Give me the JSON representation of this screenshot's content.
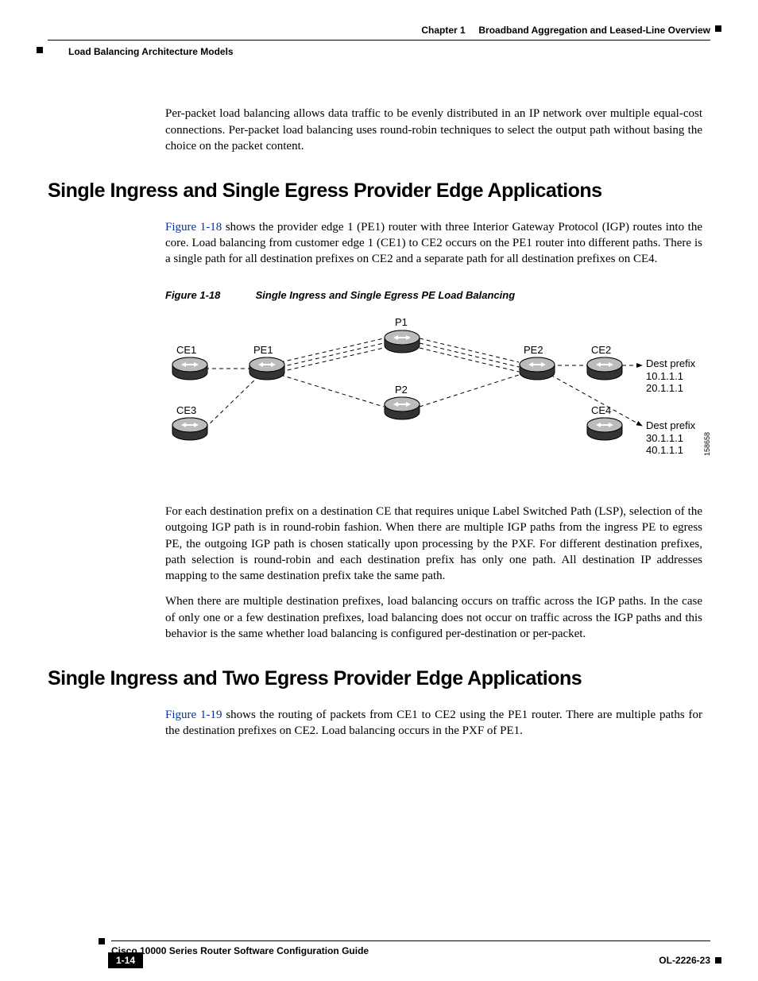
{
  "header": {
    "chapter": "Chapter 1",
    "title": "Broadband Aggregation and Leased-Line Overview",
    "section": "Load Balancing Architecture Models"
  },
  "intro": "Per-packet load balancing allows data traffic to be evenly distributed in an IP network over multiple equal-cost connections. Per-packet load balancing uses round-robin techniques to select the output path without basing the choice on the packet content.",
  "sec1": {
    "heading": "Single Ingress and Single Egress Provider Edge Applications",
    "p1_link": "Figure 1-18",
    "p1_rest": " shows the provider edge 1 (PE1) router with three Interior Gateway Protocol (IGP) routes into the core. Load balancing from customer edge 1 (CE1) to CE2 occurs on the PE1 router into different paths. There is a single path for all destination prefixes on CE2 and a separate path for all destination prefixes on CE4.",
    "fig_num": "Figure 1-18",
    "fig_title": "Single Ingress and Single Egress PE Load Balancing",
    "p2": "For each destination prefix on a destination CE that requires unique Label Switched Path (LSP), selection of the outgoing IGP path is in round-robin fashion. When there are multiple IGP paths from the ingress PE to egress PE, the outgoing IGP path is chosen statically upon processing by the PXF. For different destination prefixes, path selection is round-robin and each destination prefix has only one path. All destination IP addresses mapping to the same destination prefix take the same path.",
    "p3": "When there are multiple destination prefixes, load balancing occurs on traffic across the IGP paths. In the case of only one or a few destination prefixes, load balancing does not occur on traffic across the IGP paths and this behavior is the same whether load balancing is configured per-destination or per-packet."
  },
  "sec2": {
    "heading": "Single Ingress and Two Egress Provider Edge Applications",
    "p1_link": "Figure 1-19",
    "p1_rest": " shows the routing of packets from CE1 to CE2 using the PE1 router. There are multiple paths for the destination prefixes on CE2. Load balancing occurs in the PXF of PE1."
  },
  "diagram": {
    "nodes": {
      "ce1": "CE1",
      "ce3": "CE3",
      "pe1": "PE1",
      "p1": "P1",
      "p2": "P2",
      "pe2": "PE2",
      "ce2": "CE2",
      "ce4": "CE4"
    },
    "dest1": {
      "t": "Dest prefix",
      "a": "10.1.1.1",
      "b": "20.1.1.1"
    },
    "dest2": {
      "t": "Dest prefix",
      "a": "30.1.1.1",
      "b": "40.1.1.1"
    },
    "sideid": "158658"
  },
  "footer": {
    "booktitle": "Cisco 10000 Series Router Software Configuration Guide",
    "pagenum": "1-14",
    "docid": "OL-2226-23"
  }
}
